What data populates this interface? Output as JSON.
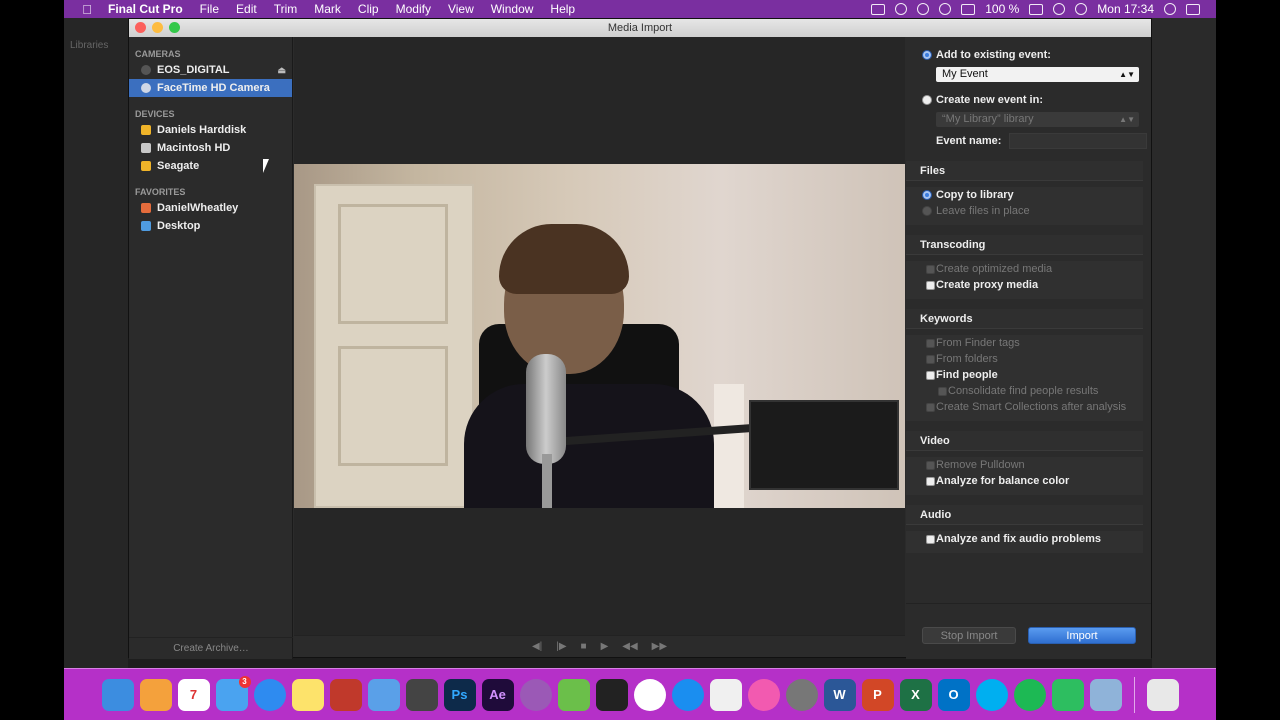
{
  "menubar": {
    "apple": "",
    "items": [
      "Final Cut Pro",
      "File",
      "Edit",
      "Trim",
      "Mark",
      "Clip",
      "Modify",
      "View",
      "Window",
      "Help"
    ],
    "battery": "100 %",
    "clock": "Mon 17:34"
  },
  "background": {
    "libraries_label": "Libraries"
  },
  "dialog": {
    "title": "Media Import"
  },
  "sources": {
    "cameras_title": "CAMERAS",
    "cameras": [
      "EOS_DIGITAL",
      "FaceTime HD Camera"
    ],
    "devices_title": "DEVICES",
    "devices": [
      "Daniels Harddisk",
      "Macintosh HD",
      "Seagate"
    ],
    "favorites_title": "FAVORITES",
    "favorites": [
      "DanielWheatley",
      "Desktop"
    ],
    "create_archive": "Create Archive…"
  },
  "options": {
    "add_existing": "Add to existing event:",
    "existing_event_value": "My Event",
    "create_new": "Create new event in:",
    "new_event_library": "“My Library” library",
    "event_name_label": "Event name:",
    "files_title": "Files",
    "copy_to_library": "Copy to library",
    "leave_in_place": "Leave files in place",
    "transcoding_title": "Transcoding",
    "create_optimized": "Create optimized media",
    "create_proxy": "Create proxy media",
    "keywords_title": "Keywords",
    "from_finder_tags": "From Finder tags",
    "from_folders": "From folders",
    "find_people": "Find people",
    "consolidate": "Consolidate find people results",
    "smart_collections": "Create Smart Collections after analysis",
    "video_title": "Video",
    "remove_pulldown": "Remove Pulldown",
    "analyze_color": "Analyze for balance color",
    "audio_title": "Audio",
    "analyze_audio": "Analyze and fix audio problems",
    "stop_import": "Stop Import",
    "import": "Import"
  },
  "dock": {
    "calendar_day": "7",
    "messages_badge": "3",
    "ps_label": "Ps",
    "ae_label": "Ae",
    "word_label": "W",
    "ppt_label": "P",
    "excel_label": "X",
    "outlook_label": "O"
  }
}
